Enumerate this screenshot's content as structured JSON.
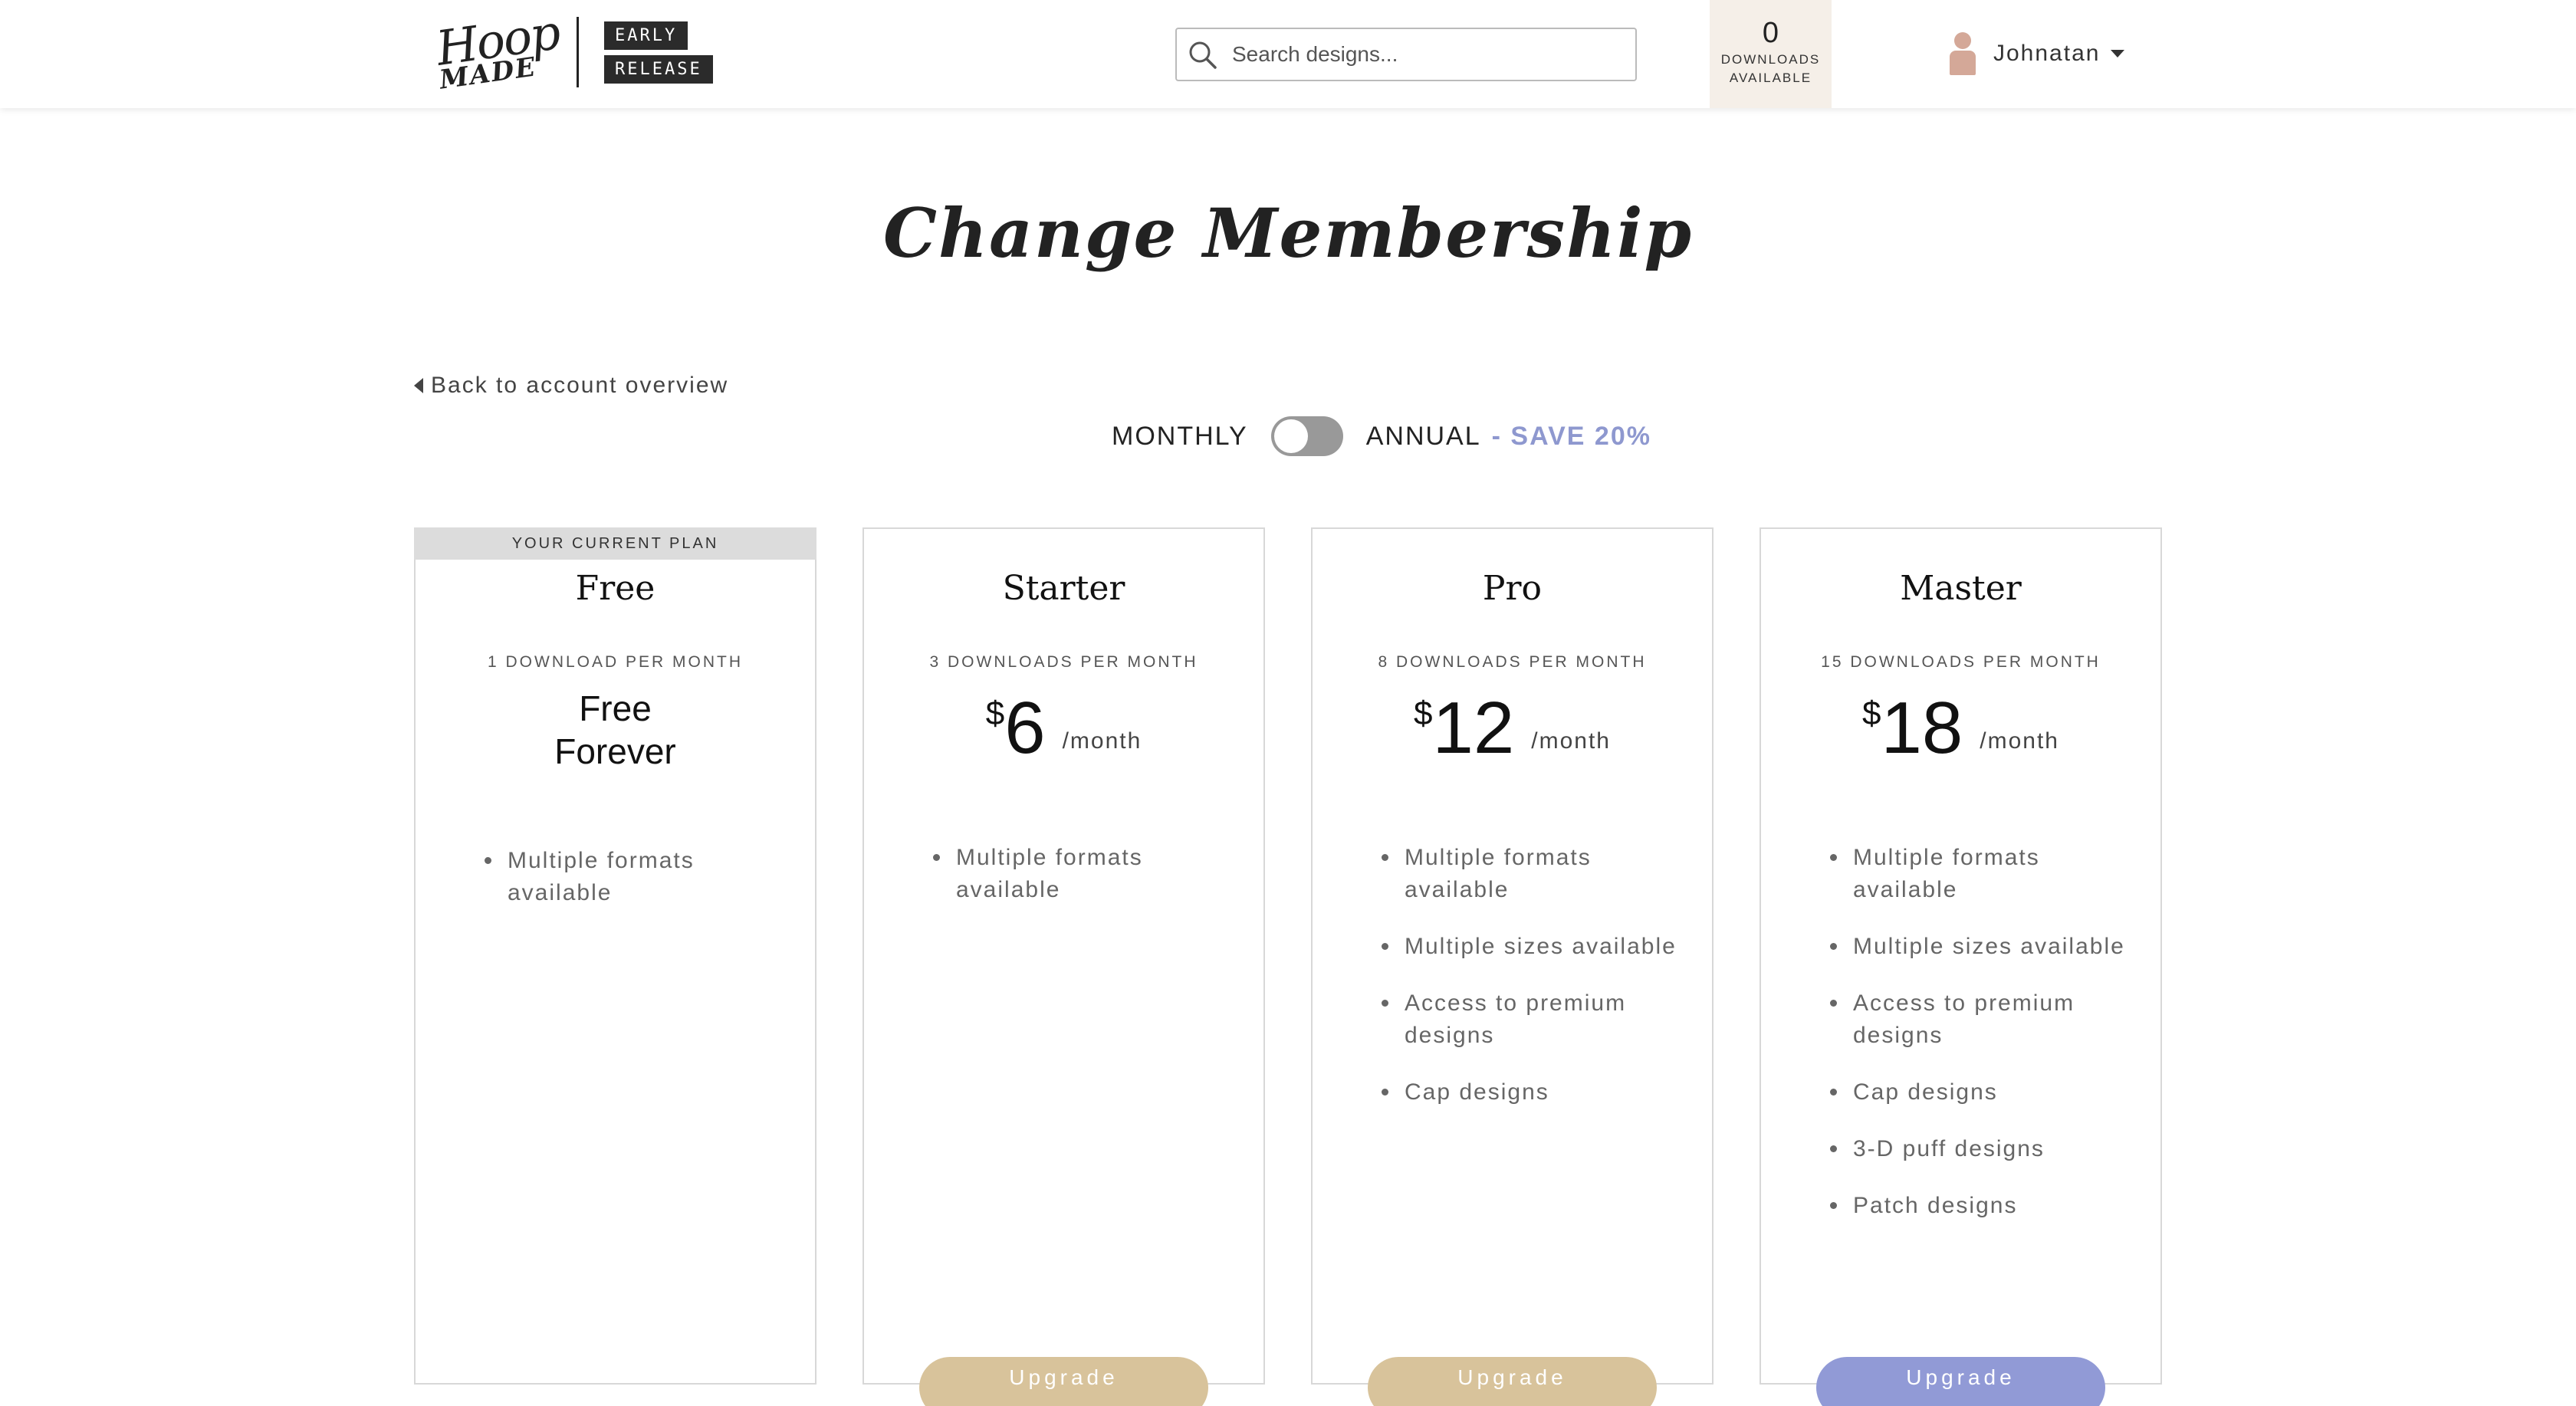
{
  "header": {
    "logo_top": "Hoop",
    "logo_bottom": "MADE",
    "badge_early": "EARLY",
    "badge_release": "RELEASE",
    "search_placeholder": "Search designs...",
    "downloads_count": "0",
    "downloads_label_1": "DOWNLOADS",
    "downloads_label_2": "AVAILABLE",
    "user_name": "Johnatan"
  },
  "page": {
    "title": "Change Membership",
    "back_link": "Back to account overview"
  },
  "billing": {
    "monthly_label": "MONTHLY",
    "annual_label": "ANNUAL",
    "save_label": "- SAVE 20%",
    "annual_selected": false
  },
  "plans": [
    {
      "current_banner": "YOUR CURRENT PLAN",
      "name": "Free",
      "downloads": "1 DOWNLOAD PER MONTH",
      "price_line_1": "Free",
      "price_line_2": "Forever",
      "features": [
        "Multiple formats available"
      ]
    },
    {
      "name": "Starter",
      "downloads": "3 DOWNLOADS PER MONTH",
      "currency": "$",
      "amount": "6",
      "period": "/month",
      "features": [
        "Multiple formats available"
      ],
      "button": "Upgrade"
    },
    {
      "name": "Pro",
      "downloads": "8 DOWNLOADS PER MONTH",
      "currency": "$",
      "amount": "12",
      "period": "/month",
      "features": [
        "Multiple formats available",
        "Multiple sizes available",
        "Access to premium designs",
        "Cap designs"
      ],
      "button": "Upgrade"
    },
    {
      "name": "Master",
      "downloads": "15 DOWNLOADS PER MONTH",
      "currency": "$",
      "amount": "18",
      "period": "/month",
      "features": [
        "Multiple formats available",
        "Multiple sizes available",
        "Access to premium designs",
        "Cap designs",
        "3-D puff designs",
        "Patch designs"
      ],
      "button": "Upgrade"
    }
  ],
  "colors": {
    "accent_tan": "#d8c39b",
    "accent_purple": "#919ad6",
    "save_text": "#8e98cf",
    "downloads_bg": "#f5efe8"
  }
}
